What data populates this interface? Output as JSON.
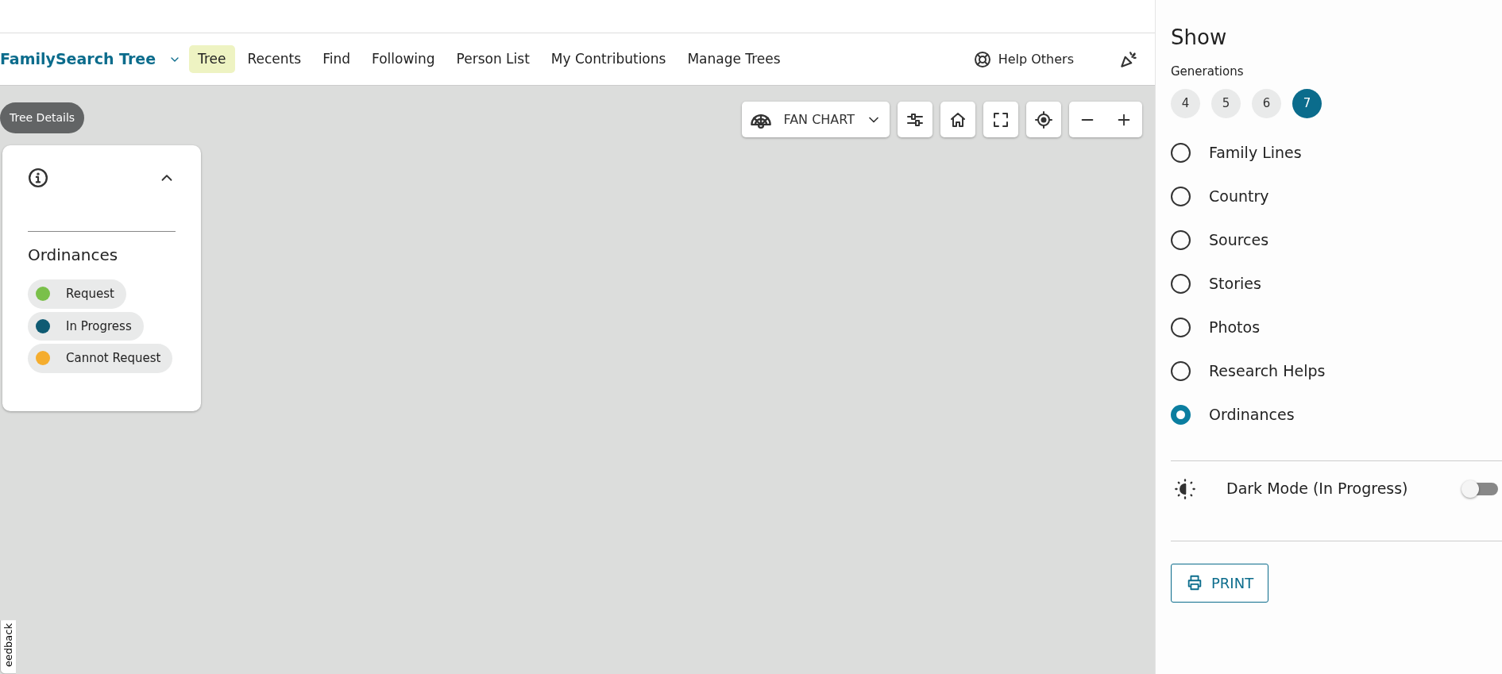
{
  "nav": {
    "brand": "FamilySearch Tree",
    "tabs": [
      {
        "label": "Tree",
        "selected": true
      },
      {
        "label": "Recents",
        "selected": false
      },
      {
        "label": "Find",
        "selected": false
      },
      {
        "label": "Following",
        "selected": false
      },
      {
        "label": "Person List",
        "selected": false
      },
      {
        "label": "My Contributions",
        "selected": false
      },
      {
        "label": "Manage Trees",
        "selected": false
      }
    ],
    "help": "Help Others"
  },
  "canvas": {
    "tree_details": "Tree Details",
    "legend": {
      "expanded": true,
      "title": "Ordinances",
      "items": [
        {
          "label": "Request",
          "color": "#7ac04a"
        },
        {
          "label": "In Progress",
          "color": "#0f5b73"
        },
        {
          "label": "Cannot Request",
          "color": "#f5ad2e"
        }
      ]
    },
    "chart_view": "FAN CHART"
  },
  "panel": {
    "title": "Show",
    "generations_label": "Generations",
    "generations": [
      {
        "label": "4",
        "selected": false
      },
      {
        "label": "5",
        "selected": false
      },
      {
        "label": "6",
        "selected": false
      },
      {
        "label": "7",
        "selected": true
      }
    ],
    "overlays": [
      {
        "label": "Family Lines",
        "selected": false
      },
      {
        "label": "Country",
        "selected": false
      },
      {
        "label": "Sources",
        "selected": false
      },
      {
        "label": "Stories",
        "selected": false
      },
      {
        "label": "Photos",
        "selected": false
      },
      {
        "label": "Research Helps",
        "selected": false
      },
      {
        "label": "Ordinances",
        "selected": true
      }
    ],
    "dark_mode": {
      "label": "Dark Mode (In Progress)",
      "on": false
    },
    "print": "PRINT"
  },
  "feedback": "eedback"
}
